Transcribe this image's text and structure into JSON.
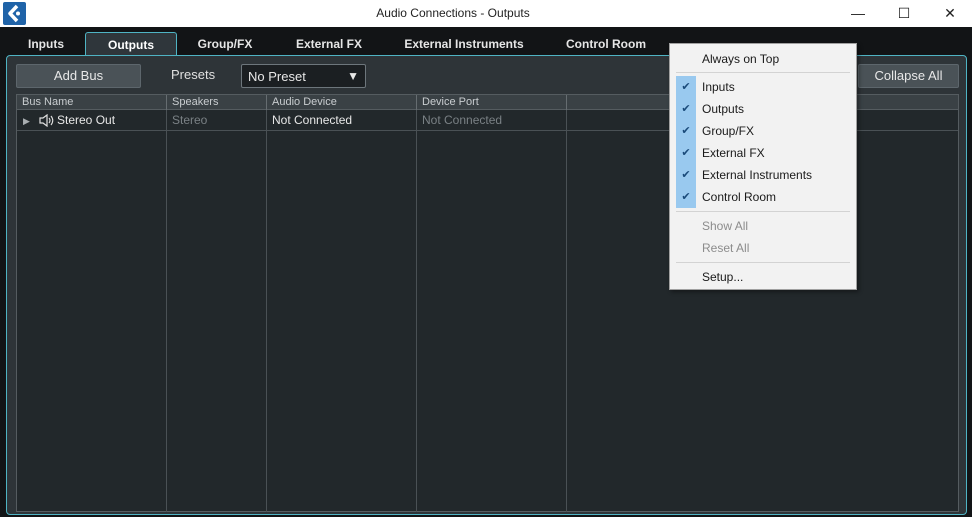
{
  "window": {
    "title": "Audio Connections - Outputs",
    "controls": {
      "minimize": "—",
      "maximize": "☐",
      "close": "✕"
    }
  },
  "tabs": [
    {
      "label": "Inputs",
      "active": false
    },
    {
      "label": "Outputs",
      "active": true
    },
    {
      "label": "Group/FX",
      "active": false
    },
    {
      "label": "External FX",
      "active": false
    },
    {
      "label": "External Instruments",
      "active": false
    },
    {
      "label": "Control Room",
      "active": false
    }
  ],
  "toolbar": {
    "add_bus_label": "Add Bus",
    "presets_label": "Presets",
    "preset_value": "No Preset",
    "collapse_all_label": "Collapse All"
  },
  "table": {
    "headers": [
      "Bus Name",
      "Speakers",
      "Audio Device",
      "Device Port"
    ],
    "rows": [
      {
        "bus_name": "Stereo Out",
        "speakers": "Stereo",
        "audio_device": "Not Connected",
        "device_port": "Not Connected"
      }
    ]
  },
  "context_menu": {
    "always_on_top": "Always on Top",
    "items": [
      {
        "label": "Inputs",
        "checked": true
      },
      {
        "label": "Outputs",
        "checked": true
      },
      {
        "label": "Group/FX",
        "checked": true
      },
      {
        "label": "External FX",
        "checked": true
      },
      {
        "label": "External Instruments",
        "checked": true
      },
      {
        "label": "Control Room",
        "checked": true
      }
    ],
    "show_all": "Show All",
    "reset_all": "Reset All",
    "setup": "Setup..."
  },
  "colors": {
    "accent": "#4fb4c4",
    "check_highlight": "#99c9ef",
    "logo": "#1f63a8"
  },
  "icons": {
    "logo": "cubase-logo-icon",
    "expand": "triangle-right-icon",
    "speaker": "speaker-icon",
    "check": "check-icon",
    "dropdown": "triangle-down-icon"
  }
}
